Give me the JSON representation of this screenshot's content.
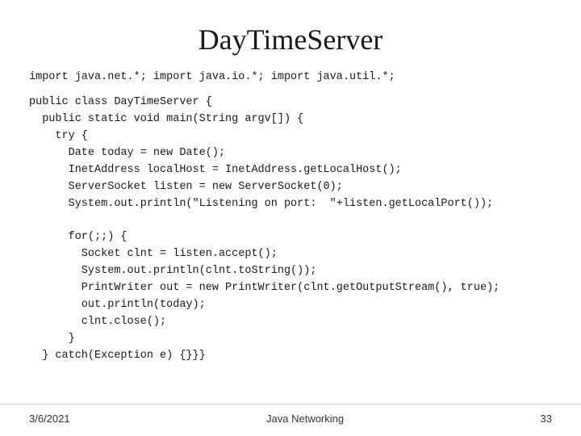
{
  "slide": {
    "title": "DayTimeServer",
    "import_line": "import java.net.*; import java.io.*; import java.util.*;",
    "code": "public class DayTimeServer {\n  public static void main(String argv[]) {\n    try {\n      Date today = new Date();\n      InetAddress localHost = InetAddress.getLocalHost();\n      ServerSocket listen = new ServerSocket(0);\n      System.out.println(\"Listening on port:  \"+listen.getLocalPort());\n\n      for(;;) {\n        Socket clnt = listen.accept();\n        System.out.println(clnt.toString());\n        PrintWriter out = new PrintWriter(clnt.getOutputStream(), true);\n        out.println(today);\n        clnt.close();\n      }\n  } catch(Exception e) {}}}",
    "footer": {
      "date": "3/6/2021",
      "title": "Java Networking",
      "page": "33"
    }
  }
}
